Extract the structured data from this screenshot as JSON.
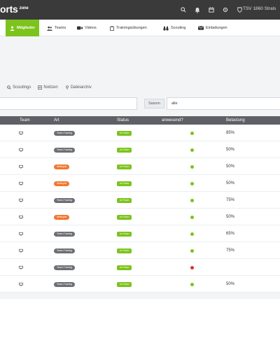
{
  "app": {
    "logo_main": "orts",
    "logo_sub": "zone",
    "club": "TSV 1860 Strals"
  },
  "nav": {
    "items": [
      {
        "label": "Mitglieder",
        "active": true,
        "icon": "user-icon"
      },
      {
        "label": "Teams",
        "icon": "users-icon"
      },
      {
        "label": "Videos",
        "icon": "video-icon"
      },
      {
        "label": "Trainingsübungen",
        "icon": "clipboard-icon"
      },
      {
        "label": "Scouting",
        "icon": "binoculars-icon"
      },
      {
        "label": "Einladungen",
        "icon": "envelope-icon"
      }
    ]
  },
  "subtabs": [
    {
      "label": "Scoutings",
      "icon": "search-icon"
    },
    {
      "label": "Notizen",
      "icon": "note-icon"
    },
    {
      "label": "Dateiarchiv",
      "icon": "pin-icon"
    }
  ],
  "filter": {
    "label": "Saison",
    "value": "alle"
  },
  "table": {
    "headers": [
      "Team",
      "Art",
      "Status",
      "anwesend?",
      "Belastung"
    ],
    "rows": [
      {
        "art": "Team-Training",
        "art_color": "grey",
        "status": "Im Team",
        "present": "yes",
        "load": "85%"
      },
      {
        "art": "Team-Training",
        "art_color": "grey",
        "status": "Im Team",
        "present": "yes",
        "load": "50%"
      },
      {
        "art": "Wettspiel",
        "art_color": "orange",
        "status": "Im Team",
        "present": "yes",
        "load": "50%"
      },
      {
        "art": "Wettspiel",
        "art_color": "orange",
        "status": "Im Team",
        "present": "yes",
        "load": "50%"
      },
      {
        "art": "Team-Training",
        "art_color": "grey",
        "status": "Im Team",
        "present": "yes",
        "load": "75%"
      },
      {
        "art": "Wettspiel",
        "art_color": "orange",
        "status": "Im Team",
        "present": "yes",
        "load": "50%"
      },
      {
        "art": "Team-Training",
        "art_color": "grey",
        "status": "Im Team",
        "present": "yes",
        "load": "65%"
      },
      {
        "art": "Team-Training",
        "art_color": "grey",
        "status": "Im Team",
        "present": "yes",
        "load": "75%"
      },
      {
        "art": "Team-Training",
        "art_color": "grey",
        "status": "Im Team",
        "present": "no",
        "load": ""
      },
      {
        "art": "Team-Training",
        "art_color": "grey",
        "status": "Im Team",
        "present": "yes",
        "load": "50%"
      }
    ]
  },
  "colors": {
    "accent": "#7cc31c",
    "topbar": "#3a3a3a",
    "table_header": "#5e6066",
    "badge_grey": "#6c6f73",
    "badge_orange": "#f2762e",
    "absent": "#d9332e"
  }
}
